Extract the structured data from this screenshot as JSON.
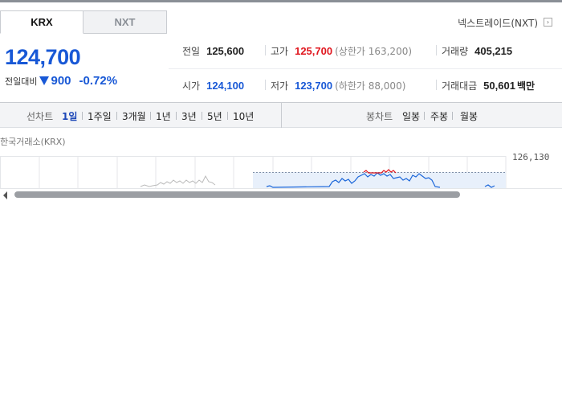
{
  "tabs": [
    {
      "label": "KRX",
      "active": true
    },
    {
      "label": "NXT",
      "active": false
    }
  ],
  "nxt_link": "넥스트레이드(NXT)",
  "nxt_link_icon": "external-link-icon",
  "price": {
    "current": "124,700",
    "change_label": "전일대비",
    "change_value": "900",
    "change_percent": "-0.72%",
    "direction_icon": "down-triangle-icon",
    "color": "#1858d6"
  },
  "stats": {
    "prev_close": {
      "label": "전일",
      "value": "125,600"
    },
    "high": {
      "label": "고가",
      "value": "125,700",
      "sub": "(상한가 163,200)",
      "color": "#e0161e"
    },
    "volume": {
      "label": "거래량",
      "value": "405,215"
    },
    "open": {
      "label": "시가",
      "value": "124,100",
      "color": "#1858d6"
    },
    "low": {
      "label": "저가",
      "value": "123,700",
      "sub": "(하한가 88,000)",
      "color": "#1858d6"
    },
    "trade_amount": {
      "label": "거래대금",
      "value": "50,601",
      "unit": "백만"
    }
  },
  "period_bar": {
    "line_chart_label": "선차트",
    "line_periods": [
      "1일",
      "1주일",
      "3개월",
      "1년",
      "3년",
      "5년",
      "10년"
    ],
    "active_period": "1일",
    "candle_chart_label": "봉차트",
    "candle_periods": [
      "일봉",
      "주봉",
      "월봉"
    ]
  },
  "chart": {
    "market_label": "한국거래소(KRX)",
    "y_tick": "126,130"
  }
}
